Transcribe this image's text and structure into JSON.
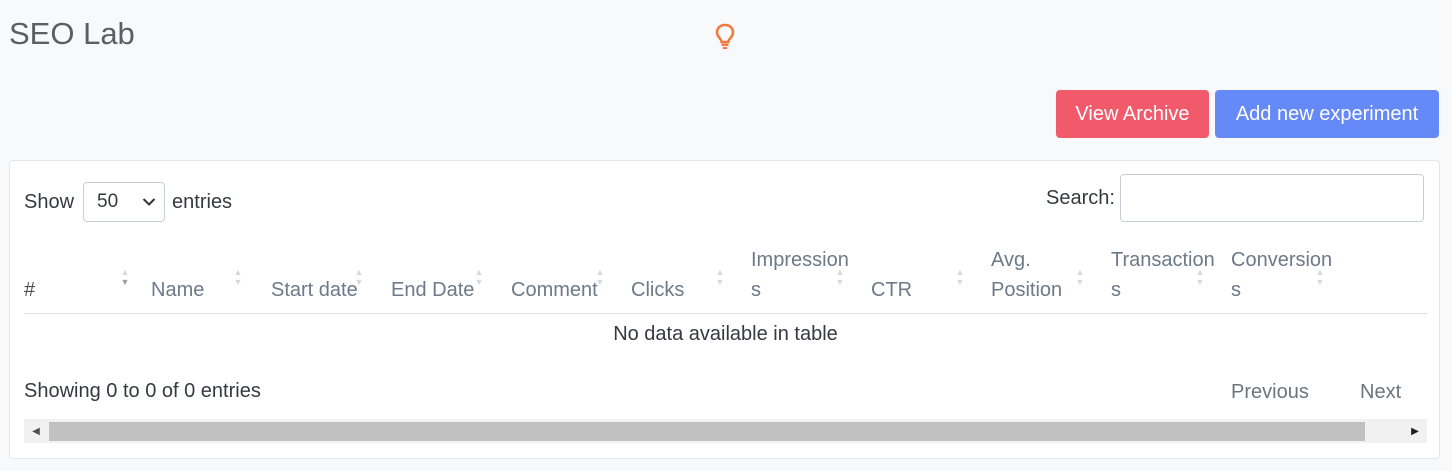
{
  "page": {
    "title": "SEO Lab"
  },
  "icons": {
    "tip": "lightbulb-icon",
    "select": "chevron-down-icon",
    "scroll_left": "caret-left-icon",
    "scroll_right": "caret-right-icon"
  },
  "colors": {
    "archive": "#f05a6b",
    "add": "#6689f8",
    "bulb": "#f07a3f"
  },
  "actions": {
    "archive_label": "View Archive",
    "add_label": "Add new experiment"
  },
  "table": {
    "length": {
      "prefix": "Show",
      "value": "50",
      "suffix": "entries"
    },
    "search": {
      "label": "Search:",
      "value": ""
    },
    "columns": [
      {
        "label": "#"
      },
      {
        "label": "Name"
      },
      {
        "label": "Start date"
      },
      {
        "label": "End Date"
      },
      {
        "label": "Comment"
      },
      {
        "label": "Clicks"
      },
      {
        "label": "Impressions"
      },
      {
        "label": "CTR"
      },
      {
        "label": "Avg. Position"
      },
      {
        "label": "Transactions"
      },
      {
        "label": "Conversions"
      }
    ],
    "empty_message": "No data available in table",
    "info": "Showing 0 to 0 of 0 entries",
    "pagination": {
      "previous": "Previous",
      "next": "Next"
    }
  }
}
